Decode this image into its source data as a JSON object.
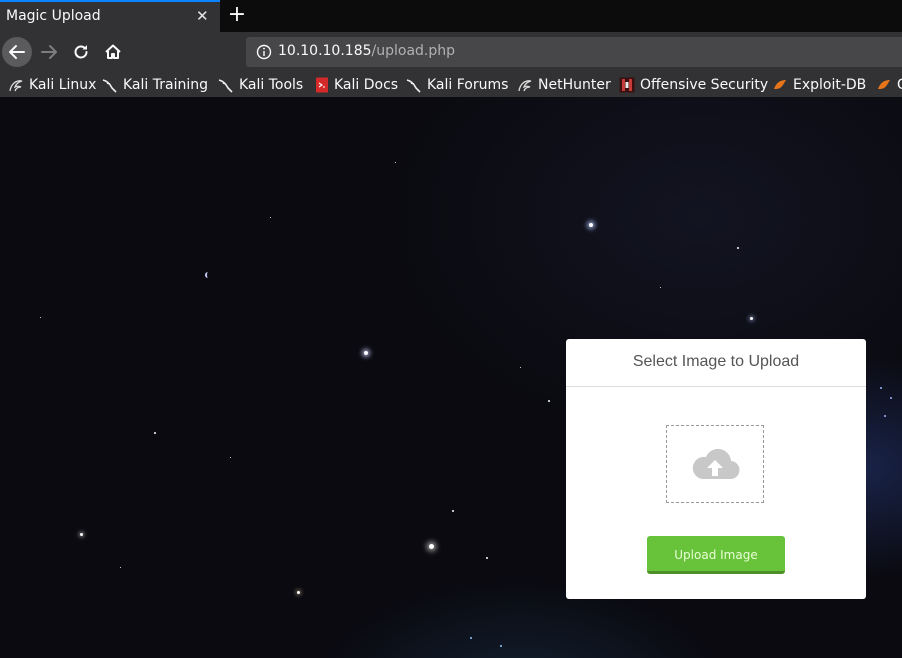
{
  "tab": {
    "title": "Magic Upload",
    "close_glyph": "✕",
    "new_tab_glyph": "+"
  },
  "navbar": {
    "url_host": "10.10.10.185",
    "url_path": "/upload.php"
  },
  "bookmarks": [
    {
      "label": "Kali Linux",
      "icon": "kali-dragon-icon"
    },
    {
      "label": "Kali Training",
      "icon": "kali-dragon-icon"
    },
    {
      "label": "Kali Tools",
      "icon": "kali-dragon-icon"
    },
    {
      "label": "Kali Docs",
      "icon": "kali-docs-icon"
    },
    {
      "label": "Kali Forums",
      "icon": "kali-dragon-icon"
    },
    {
      "label": "NetHunter",
      "icon": "kali-dragon-icon"
    },
    {
      "label": "Offensive Security",
      "icon": "offsec-icon"
    },
    {
      "label": "Exploit-DB",
      "icon": "exploit-db-icon"
    },
    {
      "label": "G",
      "icon": "exploit-db-icon"
    }
  ],
  "card": {
    "title": "Select Image to Upload",
    "upload_button": "Upload Image",
    "dropzone_icon": "cloud-upload-icon"
  },
  "colors": {
    "tab_accent": "#0a84ff",
    "button_green": "#68c23a"
  }
}
